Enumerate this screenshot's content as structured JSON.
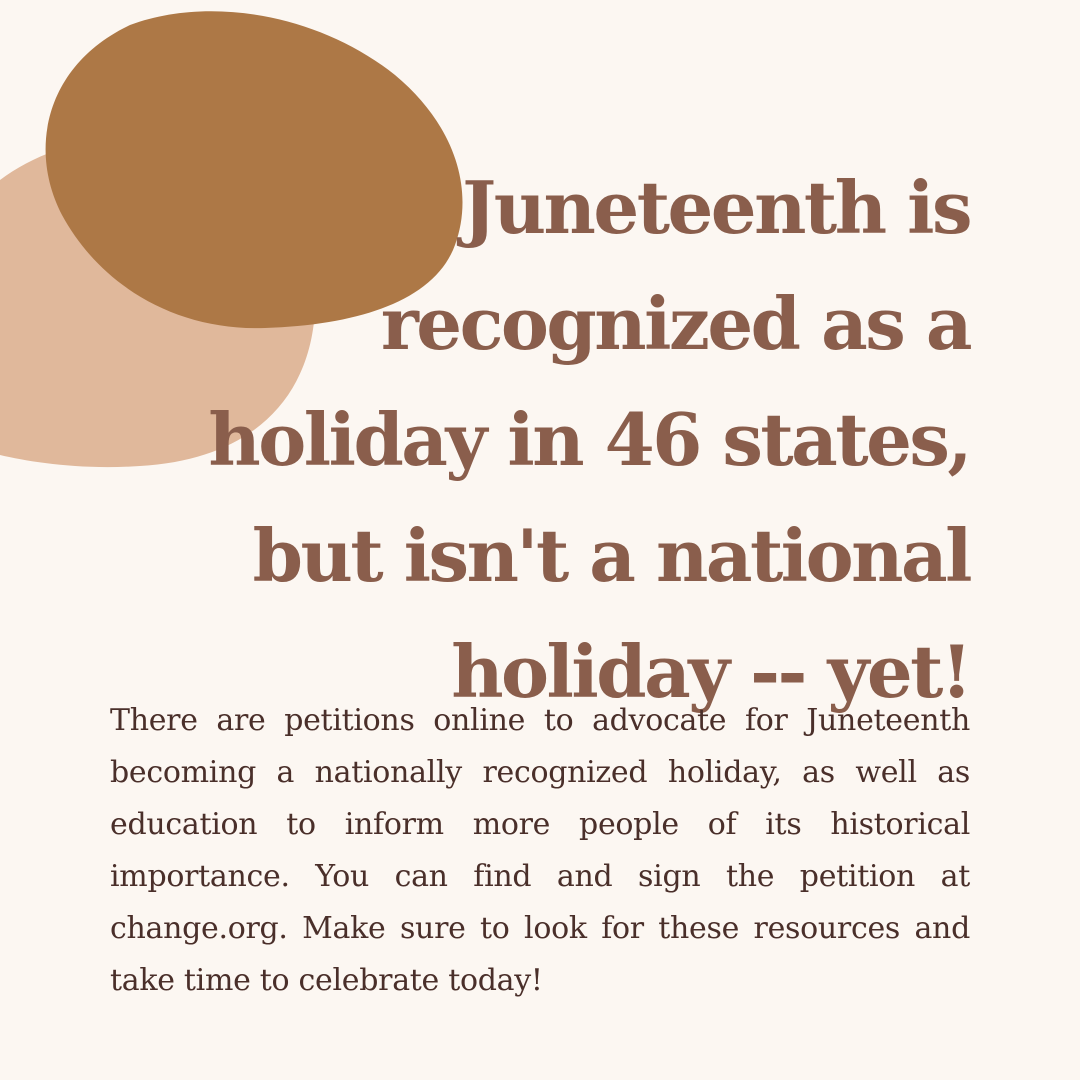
{
  "colors": {
    "background": "#fcf7f2",
    "blob_light": "#e0b89b",
    "blob_dark": "#ad7846",
    "headline": "#8a5e4c",
    "body": "#4a2f2a"
  },
  "headline": {
    "lines": [
      "Juneteenth is",
      "recognized as a",
      "holiday in 46 states,",
      "but isn't a national",
      "holiday -- yet!"
    ]
  },
  "body": {
    "text": "There are petitions online to advocate for Juneteenth becoming a nationally recognized holiday, as well as education to inform more people of its historical importance. You can find and sign the petition at change.org. Make sure to look for these resources and take time to celebrate today!"
  }
}
